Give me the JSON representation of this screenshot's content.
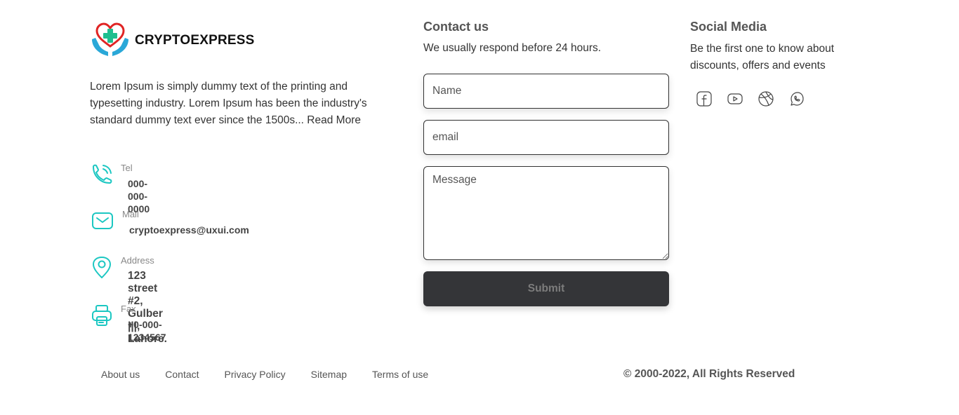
{
  "brand": {
    "name": "CRYPTOEXPRESS",
    "logo_icon": "heart-cross-hands-icon",
    "colors": {
      "heart": "#e02424",
      "cross": "#1fbf8f",
      "hands": "#2aa8d8"
    }
  },
  "about": {
    "text": "Lorem Ipsum is simply dummy text of the printing and typesetting industry. Lorem Ipsum has been the industry's standard dummy text ever since the 1500s... ",
    "read_more": "Read More"
  },
  "contact_info": {
    "icon_color": "#1cc7c2",
    "items": [
      {
        "label": "Tel",
        "value": "000-000-0000",
        "icon": "phone-icon"
      },
      {
        "label": "Mail",
        "value": "cryptoexpress@uxui.com",
        "icon": "mail-icon"
      },
      {
        "label": "Address",
        "value": "123 street #2, Gulber |||, Lahore.",
        "icon": "location-pin-icon"
      },
      {
        "label": "Fax",
        "value": "+0-000-1234567",
        "icon": "fax-icon"
      }
    ]
  },
  "contact_form": {
    "title": "Contact us",
    "subtitle": "We usually respond before 24 hours.",
    "name_placeholder": "Name",
    "email_placeholder": "email",
    "message_placeholder": "Message",
    "submit_label": "Submit",
    "submit_bg": "#343538"
  },
  "social": {
    "title": "Social Media",
    "subtitle": "Be the first one to know about discounts, offers and events",
    "icons": [
      "facebook-icon",
      "youtube-icon",
      "dribbble-icon",
      "whatsapp-icon"
    ]
  },
  "footer": {
    "links": [
      "About us",
      "Contact",
      "Privacy Policy",
      "Sitemap",
      "Terms of use"
    ],
    "copyright": "© 2000-2022, All Rights Reserved"
  }
}
